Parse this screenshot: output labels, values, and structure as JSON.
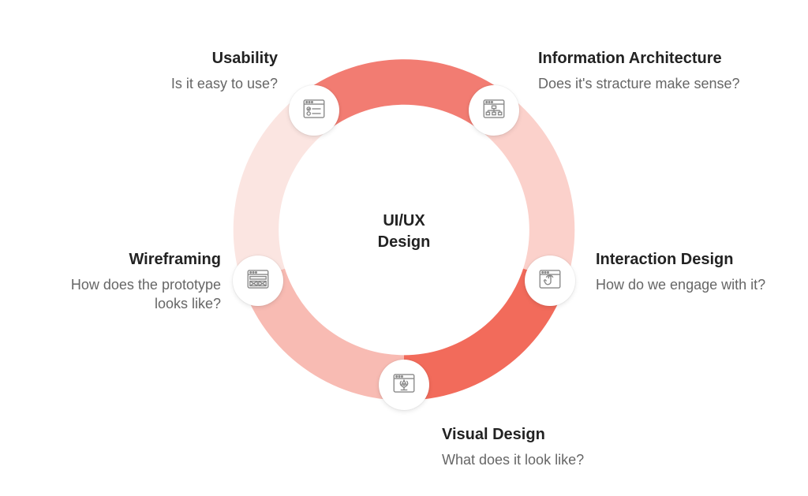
{
  "center": {
    "line1": "UI/UX",
    "line2": "Design"
  },
  "segments": [
    {
      "key": "usability",
      "title": "Usability",
      "desc": "Is it easy to use?",
      "color": "#f27c72",
      "icon": "checklist-window-icon"
    },
    {
      "key": "info_arch",
      "title": "Information Architecture",
      "desc": "Does it's stracture make sense?",
      "color": "#fbd1cb",
      "icon": "sitemap-window-icon"
    },
    {
      "key": "interaction",
      "title": "Interaction Design",
      "desc": "How do we engage with it?",
      "color": "#f26b5b",
      "icon": "touch-window-icon"
    },
    {
      "key": "visual",
      "title": "Visual Design",
      "desc": "What does it look like?",
      "color": "#f8bbb3",
      "icon": "pen-window-icon"
    },
    {
      "key": "wireframing",
      "title": "Wireframing",
      "desc": "How does the prototype looks like?",
      "color": "#fbe5e1",
      "icon": "wireframe-window-icon"
    }
  ]
}
